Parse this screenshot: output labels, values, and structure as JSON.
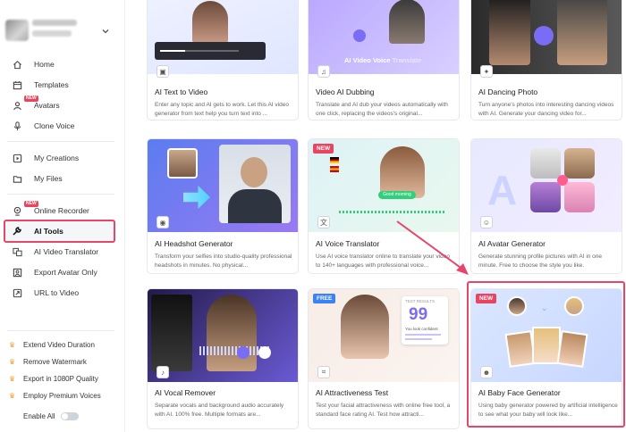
{
  "sidebar": {
    "nav": [
      {
        "label": "Home",
        "icon": "home-icon"
      },
      {
        "label": "Templates",
        "icon": "templates-icon"
      },
      {
        "label": "Avatars",
        "icon": "avatars-icon",
        "badge": "NEW"
      },
      {
        "label": "Clone Voice",
        "icon": "microphone-icon"
      },
      {
        "label": "My Creations",
        "icon": "play-square-icon"
      },
      {
        "label": "My Files",
        "icon": "folder-icon"
      },
      {
        "label": "Online Recorder",
        "icon": "webcam-icon",
        "badge": "NEW"
      },
      {
        "label": "AI Tools",
        "icon": "tools-icon",
        "active": true
      },
      {
        "label": "AI Video Translator",
        "icon": "translate-icon"
      },
      {
        "label": "Export Avatar Only",
        "icon": "export-avatar-icon"
      },
      {
        "label": "URL to Video",
        "icon": "link-icon"
      }
    ],
    "perks": [
      "Extend Video Duration",
      "Remove Watermark",
      "Export in 1080P Quality",
      "Employ Premium Voices"
    ],
    "enable_all": "Enable All"
  },
  "cards": [
    {
      "title": "AI Text to Video",
      "desc": "Enter any topic and AI gets to work. Let this AI video generator from text help you turn text into ...",
      "icon": "video-icon"
    },
    {
      "title": "Video AI Dubbing",
      "desc": "Translate and AI dub your videos automatically with one click, replacing the videos's original...",
      "icon": "dubbing-icon",
      "thumb_text": "AI Video Voice",
      "thumb_text2": "Translate"
    },
    {
      "title": "AI Dancing Photo",
      "desc": "Turn anyone's photos into interesting dancing videos with AI. Generate your dancing video for...",
      "icon": "dance-icon"
    },
    {
      "title": "AI Headshot Generator",
      "desc": "Transform your selfies into studio-quality professional headshots in minutes. No physical...",
      "icon": "headshot-icon"
    },
    {
      "title": "AI Voice Translator",
      "desc": "Use AI voice translator online to translate your video to 140+ languages with professional voice...",
      "icon": "translate-icon",
      "badge": "NEW",
      "thumb_text": "Good morning"
    },
    {
      "title": "AI Avatar Generator",
      "desc": "Generate stunning profile pictures with AI in one minute. Free to choose the style you like.",
      "icon": "avatar-icon"
    },
    {
      "title": "AI Vocal Remover",
      "desc": "Separate vocals and background audio accurately with AI. 100% free. Multiple formats are...",
      "icon": "vocal-icon"
    },
    {
      "title": "AI Attractiveness Test",
      "desc": "Test your facial attractiveness with online free tool, a standard face rating AI. Test how attracti...",
      "icon": "face-scan-icon",
      "badge": "FREE",
      "score": "99",
      "thumb_text": "TEST RESULTS",
      "thumb_text2": "You look confident"
    },
    {
      "title": "AI Baby Face Generator",
      "desc": "Using baby generator powered by artificial intelligence to see what your baby will look like...",
      "icon": "baby-icon",
      "badge": "NEW"
    }
  ],
  "colors": {
    "accent": "#e8456b",
    "brand_purple": "#7b6cf6",
    "new_badge": "#e94560",
    "free_badge": "#3b82f6"
  }
}
